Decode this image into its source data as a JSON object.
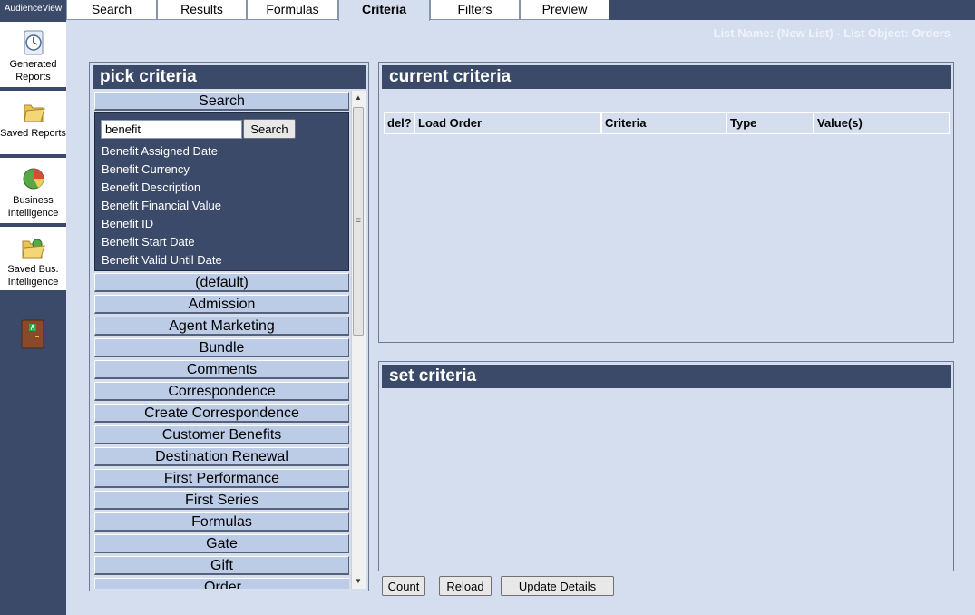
{
  "app": {
    "title": "AudienceView"
  },
  "sidebar": {
    "items": [
      {
        "label": "Generated Reports",
        "icon": "clock-report-icon"
      },
      {
        "label": "Saved Reports",
        "icon": "folder-icon"
      },
      {
        "label": "Business Intelligence",
        "icon": "pie-chart-icon"
      },
      {
        "label": "Saved Bus. Intelligence",
        "icon": "folder-open-icon"
      }
    ],
    "exit_icon": "exit-door-icon"
  },
  "tabs": [
    {
      "label": "Search"
    },
    {
      "label": "Results"
    },
    {
      "label": "Formulas"
    },
    {
      "label": "Criteria",
      "active": true
    },
    {
      "label": "Filters"
    },
    {
      "label": "Preview"
    }
  ],
  "list_name": "List Name: (New List) - List Object: Orders",
  "pick_criteria": {
    "title": "pick criteria",
    "search_header": "Search",
    "search_value": "benefit",
    "search_button": "Search",
    "results": [
      "Benefit Assigned Date",
      "Benefit Currency",
      "Benefit Description",
      "Benefit Financial Value",
      "Benefit ID",
      "Benefit Start Date",
      "Benefit Valid Until Date"
    ],
    "categories": [
      "(default)",
      "Admission",
      "Agent Marketing",
      "Bundle",
      "Comments",
      "Correspondence",
      "Create Correspondence",
      "Customer Benefits",
      "Destination Renewal",
      "First Performance",
      "First Series",
      "Formulas",
      "Gate",
      "Gift",
      "Order"
    ]
  },
  "current_criteria": {
    "title": "current criteria",
    "columns": [
      "del?",
      "Load Order",
      "Criteria",
      "Type",
      "Value(s)"
    ]
  },
  "set_criteria": {
    "title": "set criteria"
  },
  "actions": {
    "count": "Count",
    "reload": "Reload",
    "update": "Update Details"
  },
  "colors": {
    "navy": "#3b4a68",
    "background": "#d4deef",
    "category": "#bccbe6"
  }
}
